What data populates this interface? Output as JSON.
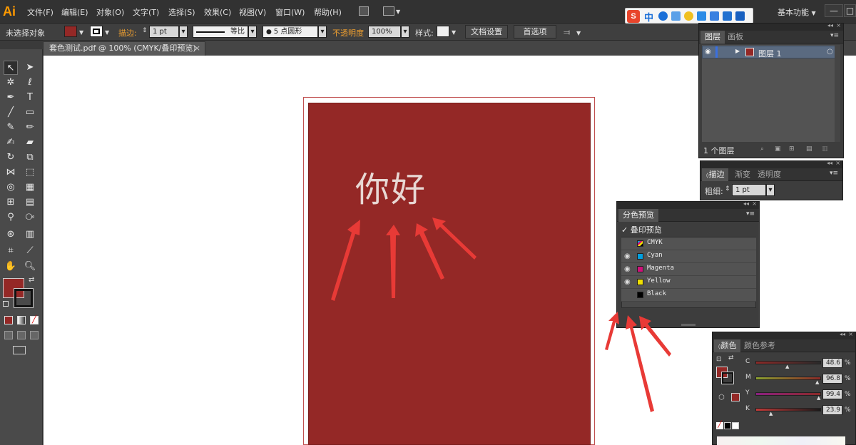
{
  "app": {
    "logo": "Ai",
    "workspace": "基本功能"
  },
  "menu": [
    "文件(F)",
    "编辑(E)",
    "对象(O)",
    "文字(T)",
    "选择(S)",
    "效果(C)",
    "视图(V)",
    "窗口(W)",
    "帮助(H)"
  ],
  "ime": {
    "logo": "S",
    "mode": "中"
  },
  "window_controls": {
    "minimize": "—",
    "restore": "□"
  },
  "control": {
    "selection_state": "未选择对象",
    "stroke_label": "描边:",
    "stroke_weight": "1 pt",
    "stroke_profile": "等比",
    "brush": "5 点圆形",
    "opacity_label": "不透明度",
    "opacity_value": "100%",
    "style_label": "样式:",
    "doc_setup": "文档设置",
    "preferences": "首选项",
    "fill_color": "#942826"
  },
  "document_tab": {
    "title": "套色测试.pdf @ 100% (CMYK/叠印预览)",
    "close": "×"
  },
  "artwork": {
    "text": "你好",
    "fill_color": "#942826"
  },
  "layers_panel": {
    "tabs": [
      "图层",
      "画板"
    ],
    "layer_name": "图层 1",
    "footer": "1 个图层"
  },
  "stroke_panel": {
    "tabs": [
      "描边",
      "渐变",
      "透明度"
    ],
    "weight_label": "粗细:",
    "weight_value": "1 pt"
  },
  "separations_panel": {
    "title": "分色预览",
    "overprint_label": "叠印预览",
    "check": "✓",
    "plates": [
      {
        "name": "CMYK",
        "color": "#888888",
        "visible": false
      },
      {
        "name": "Cyan",
        "color": "#00a0e0",
        "visible": true
      },
      {
        "name": "Magenta",
        "color": "#d0107a",
        "visible": true
      },
      {
        "name": "Yellow",
        "color": "#f0e000",
        "visible": true
      },
      {
        "name": "Black",
        "color": "#000000",
        "visible": false
      }
    ]
  },
  "color_panel": {
    "tabs": [
      "颜色",
      "颜色参考"
    ],
    "channels": [
      {
        "label": "C",
        "value": "48.6",
        "unit": "%",
        "level": 0.486
      },
      {
        "label": "M",
        "value": "96.8",
        "unit": "%",
        "level": 0.968
      },
      {
        "label": "Y",
        "value": "99.4",
        "unit": "%",
        "level": 0.994
      },
      {
        "label": "K",
        "value": "23.9",
        "unit": "%",
        "level": 0.239
      }
    ]
  },
  "colors": {
    "accent_orange": "#f0a030",
    "arrow_red": "#e83a36"
  }
}
